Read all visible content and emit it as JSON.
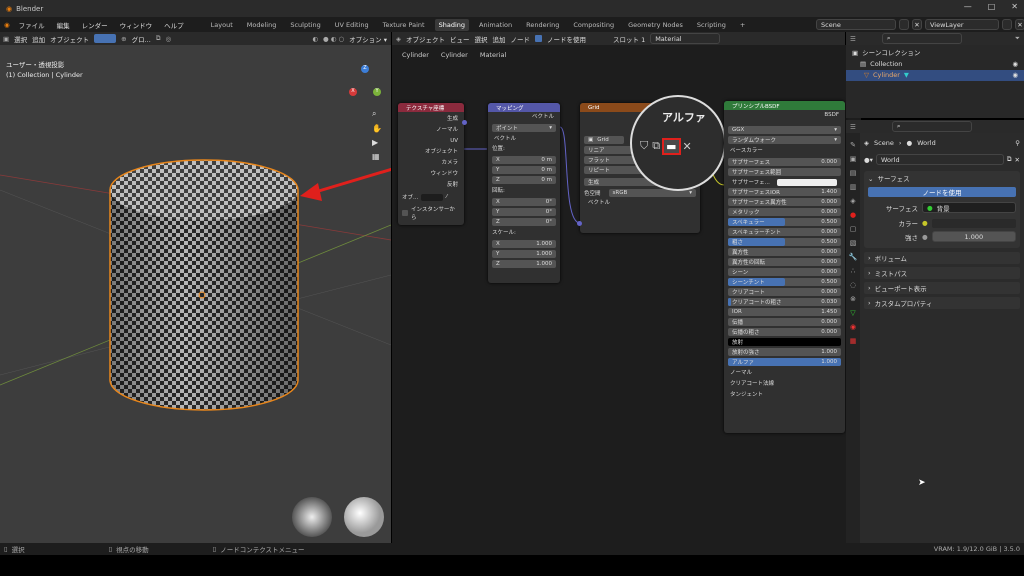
{
  "titlebar": {
    "app": "Blender",
    "minimize": "—",
    "maximize": "□",
    "close": "✕"
  },
  "menubar": {
    "items": [
      "ファイル",
      "編集",
      "レンダー",
      "ウィンドウ",
      "ヘルプ"
    ],
    "workspaces": [
      "Layout",
      "Modeling",
      "Sculpting",
      "UV Editing",
      "Texture Paint",
      "Shading",
      "Animation",
      "Rendering",
      "Compositing",
      "Geometry Nodes",
      "Scripting"
    ],
    "active_workspace": "Shading",
    "add": "+",
    "scene": "Scene",
    "viewlayer": "ViewLayer"
  },
  "viewport": {
    "header": [
      "選択",
      "追加",
      "オブジェクト",
      "グロ..."
    ],
    "options": "オプション ▾",
    "info_line1": "ユーザー・透視投影",
    "info_line2": "(1) Collection | Cylinder",
    "gizmo": {
      "x": "X",
      "y": "Y",
      "z": "Z"
    }
  },
  "nodeeditor": {
    "header": [
      "オブジェクト",
      "ビュー",
      "選択",
      "追加",
      "ノード"
    ],
    "use_nodes": "ノードを使用",
    "slot": "スロット 1",
    "material": "Material",
    "breadcrumb": [
      "Cylinder",
      "Cylinder",
      "Material"
    ],
    "texcoord": {
      "title": "テクスチャ座標",
      "outputs": [
        "生成",
        "ノーマル",
        "UV",
        "オブジェクト",
        "カメラ",
        "ウィンドウ",
        "反射"
      ],
      "obj_label": "オブ...",
      "instancer": "インスタンサーから"
    },
    "mapping": {
      "title": "マッピング",
      "out": "ベクトル",
      "type": "ポイント",
      "vector": "ベクトル",
      "loc": "位置:",
      "rot": "回転:",
      "scale": "スケール:",
      "loc_vals": [
        [
          "X",
          "0 m"
        ],
        [
          "Y",
          "0 m"
        ],
        [
          "Z",
          "0 m"
        ]
      ],
      "rot_vals": [
        [
          "X",
          "0°"
        ],
        [
          "Y",
          "0°"
        ],
        [
          "Z",
          "0°"
        ]
      ],
      "scale_vals": [
        [
          "X",
          "1.000"
        ],
        [
          "Y",
          "1.000"
        ],
        [
          "Z",
          "1.000"
        ]
      ]
    },
    "grid": {
      "title": "Grid",
      "name": "Grid",
      "interp": "リニア",
      "proj": "フラット",
      "ext": "リピート",
      "src": "生成",
      "cs_label": "色空間",
      "cs": "sRGB",
      "vector": "ベクトル"
    },
    "zoom": {
      "label": "アルファ"
    },
    "bsdf": {
      "title": "プリンシプルBSDF",
      "out": "BSDF",
      "dist": "GGX",
      "sss_method": "ランダムウォーク",
      "base": "ベースカラー",
      "rows": [
        [
          "サブサーフェス",
          "0.000",
          0
        ],
        [
          "サブサーフェス範囲",
          "",
          0
        ],
        [
          "サブサーフェ...",
          "",
          0
        ],
        [
          "サブサーフェスIOR",
          "1.400",
          0
        ],
        [
          "サブサーフェス異方性",
          "0.000",
          0
        ],
        [
          "メタリック",
          "0.000",
          0
        ],
        [
          "スペキュラー",
          "0.500",
          0.5
        ],
        [
          "スペキュラーチント",
          "0.000",
          0
        ],
        [
          "粗さ",
          "0.500",
          0.5
        ],
        [
          "異方性",
          "0.000",
          0
        ],
        [
          "異方性の回転",
          "0.000",
          0
        ],
        [
          "シーン",
          "0.000",
          0
        ],
        [
          "シーンチント",
          "0.500",
          0.5
        ],
        [
          "クリアコート",
          "0.000",
          0
        ],
        [
          "クリアコートの粗さ",
          "0.030",
          0.03
        ],
        [
          "IOR",
          "1.450",
          0
        ],
        [
          "伝播",
          "0.000",
          0
        ],
        [
          "伝播の粗さ",
          "0.000",
          0
        ],
        [
          "放射",
          "",
          0
        ],
        [
          "放射の強さ",
          "1.000",
          0
        ],
        [
          "アルファ",
          "1.000",
          1
        ]
      ],
      "tail": [
        "ノーマル",
        "クリアコート法線",
        "タンジェント"
      ]
    }
  },
  "outliner": {
    "title": "シーンコレクション",
    "collection": "Collection",
    "object": "Cylinder"
  },
  "props": {
    "scene": "Scene",
    "world_crumb": "World",
    "world": "World",
    "surface_panel": "サーフェス",
    "use_nodes": "ノードを使用",
    "surface_label": "サーフェス",
    "surface_val": "背景",
    "color_label": "カラー",
    "strength_label": "強さ",
    "strength_val": "1.000",
    "panels": [
      "ボリューム",
      "ミストパス",
      "ビューポート表示",
      "カスタムプロパティ"
    ]
  },
  "statusbar": {
    "select": "選択",
    "move": "視点の移動",
    "ctx": "ノードコンテクストメニュー",
    "vram": "VRAM: 1.9/12.0 GiB | 3.5.0"
  },
  "colors": {
    "accent": "#4772b3",
    "highlight": "#e0201c",
    "selection_outline": "#e8861b"
  }
}
